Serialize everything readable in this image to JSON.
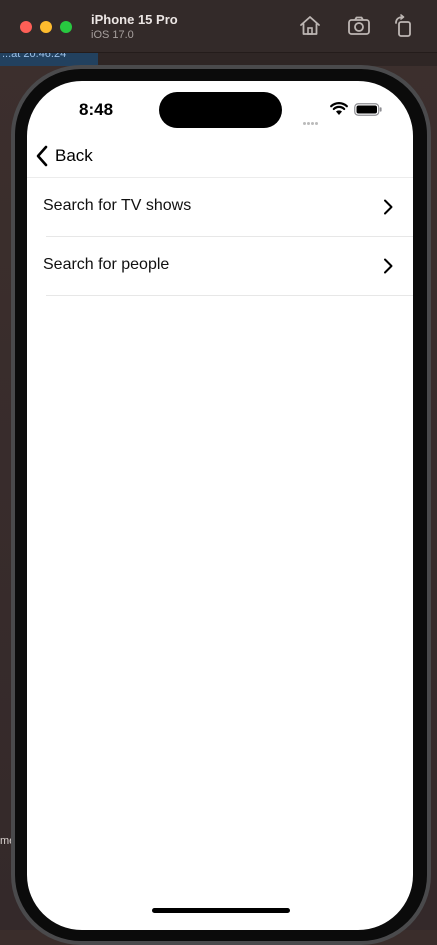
{
  "simulator": {
    "device_name": "iPhone 15 Pro",
    "os_version": "iOS 17.0",
    "toolbar_icons": [
      "home-icon",
      "screenshot-icon",
      "rotate-icon"
    ]
  },
  "background": {
    "tab_text": "...at 20.46.24",
    "edge_text": "me"
  },
  "status_bar": {
    "time": "8:48",
    "icons": [
      "cellular-dots-icon",
      "wifi-icon",
      "battery-icon"
    ]
  },
  "nav": {
    "back_label": "Back",
    "back_icon": "chevron-left-icon"
  },
  "list": {
    "items": [
      {
        "label": "Search for TV shows",
        "icon": "chevron-right-icon"
      },
      {
        "label": "Search for people",
        "icon": "chevron-right-icon"
      }
    ]
  },
  "colors": {
    "titlebar": "#332a29",
    "traffic_close": "#fe5f57",
    "traffic_minimize": "#febc2e",
    "traffic_maximize": "#28c840",
    "screen_bg": "#ffffff",
    "text": "#000000"
  }
}
